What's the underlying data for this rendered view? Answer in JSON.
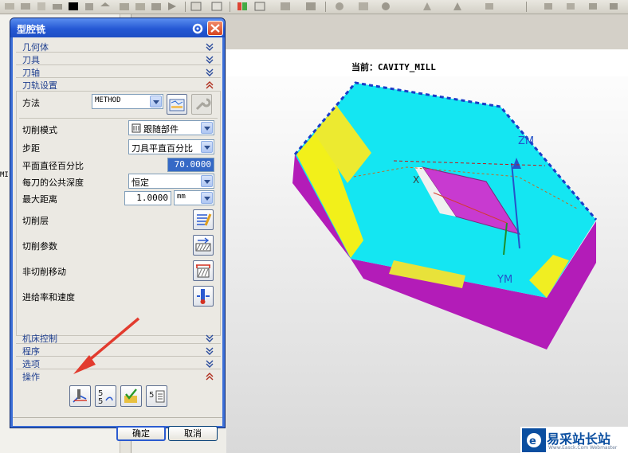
{
  "viewport": {
    "label": "当前：CAVITY_MILL",
    "axis_z": "ZM",
    "axis_y": "YM",
    "axis_x": "X"
  },
  "background_fragment": "MI",
  "dialog": {
    "title": "型腔铣",
    "sections": {
      "geometry": "几何体",
      "tool": "刀具",
      "tool_axis": "刀轴",
      "path_settings": "刀轨设置",
      "machine_control": "机床控制",
      "program": "程序",
      "options": "选项",
      "actions": "操作"
    },
    "fields": {
      "method_label": "方法",
      "method_value": "METHOD",
      "cut_pattern_label": "切削模式",
      "cut_pattern_value": "跟随部件",
      "stepover_label": "步距",
      "stepover_value": "刀具平直百分比",
      "flat_diameter_label": "平面直径百分比",
      "flat_diameter_value": "70.0000",
      "depth_label": "每刀的公共深度",
      "depth_value": "恒定",
      "max_distance_label": "最大距离",
      "max_distance_value": "1.0000",
      "unit_value": "mm",
      "cut_levels_label": "切削层",
      "cut_params_label": "切削参数",
      "non_cutting_label": "非切削移动",
      "feeds_label": "进给率和速度"
    },
    "buttons": {
      "ok": "确定",
      "cancel": "取消"
    }
  },
  "watermark": {
    "text": "易采站长站",
    "sub": "Www.Easck.Com Webmaster"
  },
  "colors": {
    "title_bar": "#2558d4",
    "section_text": "#1f3f8f",
    "accent": "#3569c6"
  }
}
